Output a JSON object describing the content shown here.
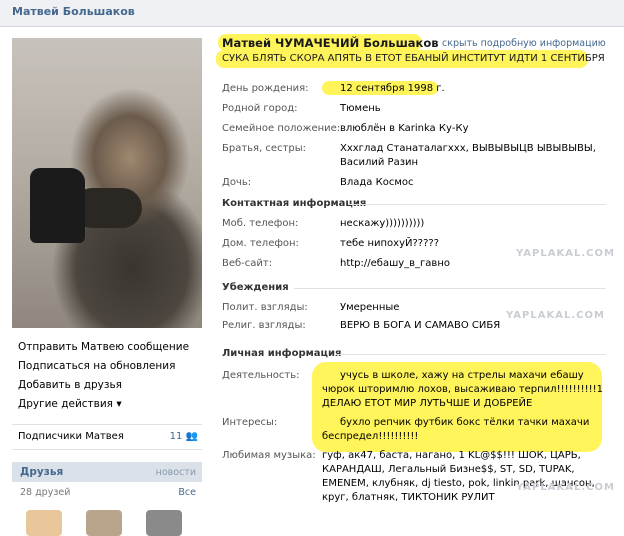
{
  "header": {
    "name": "Матвей Большаков"
  },
  "left": {
    "menu": [
      "Отправить Матвею сообщение",
      "Подписаться на обновления",
      "Добавить в друзья",
      "Другие действия ▾"
    ],
    "subscribers": {
      "label": "Подписчики Матвея",
      "count": "11"
    },
    "friends": {
      "title": "Друзья",
      "news": "новости",
      "count": "28 друзей",
      "all": "Все"
    }
  },
  "profile": {
    "full_name": "Матвей ЧУМАЧЕЧИЙ Большаков",
    "hide_link": "скрыть подробную информацию",
    "status": "СУКА БЛЯТЬ СКОРА АПЯТЬ В ЕТОТ ЕБАНЫЙ ИНСТИТУТ ИДТИ 1 СЕНТИБРЯ",
    "basic": [
      {
        "k": "День рождения:",
        "v": "12 сентября 1998 г."
      },
      {
        "k": "Родной город:",
        "v": "Тюмень"
      },
      {
        "k": "Семейное положение:",
        "v": "влюблён в Karinka Ку-Ку"
      },
      {
        "k": "Братья, сестры:",
        "v": "Ххxглад Станаталагххх, ВЫВЫВЫЦВ ЫВЫВЫВЫ,"
      },
      {
        "k": "",
        "v": "Василий Разин"
      },
      {
        "k": "Дочь:",
        "v": "Влада Космос"
      }
    ],
    "contact_title": "Контактная информация",
    "contact": [
      {
        "k": "Моб. телефон:",
        "v": "нескажу))))))))))"
      },
      {
        "k": "Дом. телефон:",
        "v": "тебе нипохуЙ?????"
      },
      {
        "k": "Веб-сайт:",
        "v": "http://ебашу_в_гавно"
      }
    ],
    "beliefs_title": "Убеждения",
    "beliefs": [
      {
        "k": "Полит. взгляды:",
        "v": "Умеренные"
      },
      {
        "k": "Религ. взгляды:",
        "v": "ВЕРЮ В БОГА И САМАВО СИБЯ"
      }
    ],
    "personal_title": "Личная информация",
    "activity_label": "Деятельность:",
    "activity": [
      "учусь в школе, хажу на стрелы махачи ебашу",
      "чюрок шторимлю лохов, высаживаю терпил!!!!!!!!!!1",
      "ДЕЛАЮ ЕТОТ МИР ЛУТЬЧШЕ И ДОБРЕЙЕ"
    ],
    "interests_label": "Интересы:",
    "interests": [
      "бухло репчик футбик бокс тёлки тачки махачи",
      "беспредел!!!!!!!!!!"
    ],
    "music_label": "Любимая музыка:",
    "music": [
      "гуф, ак47, баста, нагано, 1 KL@$$!!! ШОК, ЦАРЬ,",
      "КАРАНДАШ, Легальный Бизне$$, ST, SD, TUPAK,",
      "EMENEM, клубняк, dj tiesto, pok, linkin park, шансон,",
      "круг, блатняк, ТИКТОНИК РУЛИТ"
    ]
  },
  "watermark": "YAPLAKAL.COM",
  "colors": {
    "highlight": "#fff45a",
    "link": "#45688e"
  }
}
